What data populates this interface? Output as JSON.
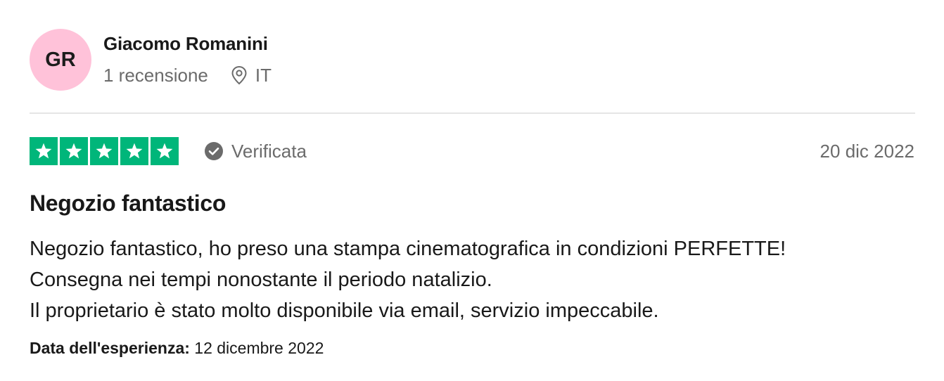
{
  "reviewer": {
    "initials": "GR",
    "name": "Giacomo Romanini",
    "reviews_count": "1 recensione",
    "country": "IT",
    "avatar_color": "#ffc2d9",
    "location_icon": "location-pin-icon"
  },
  "rating": {
    "stars": 5,
    "max": 5,
    "star_color": "#00b67a",
    "verified_label": "Verificata",
    "verified_icon": "check-circle-icon"
  },
  "review": {
    "date": "20 dic 2022",
    "title": "Negozio fantastico",
    "lines": [
      "Negozio fantastico, ho preso una stampa cinematografica in condizioni PERFETTE!",
      "Consegna nei tempi nonostante il periodo natalizio.",
      "Il proprietario è stato molto disponibile via email, servizio impeccabile."
    ],
    "experience_label": "Data dell'esperienza:",
    "experience_date": "12 dicembre 2022"
  }
}
